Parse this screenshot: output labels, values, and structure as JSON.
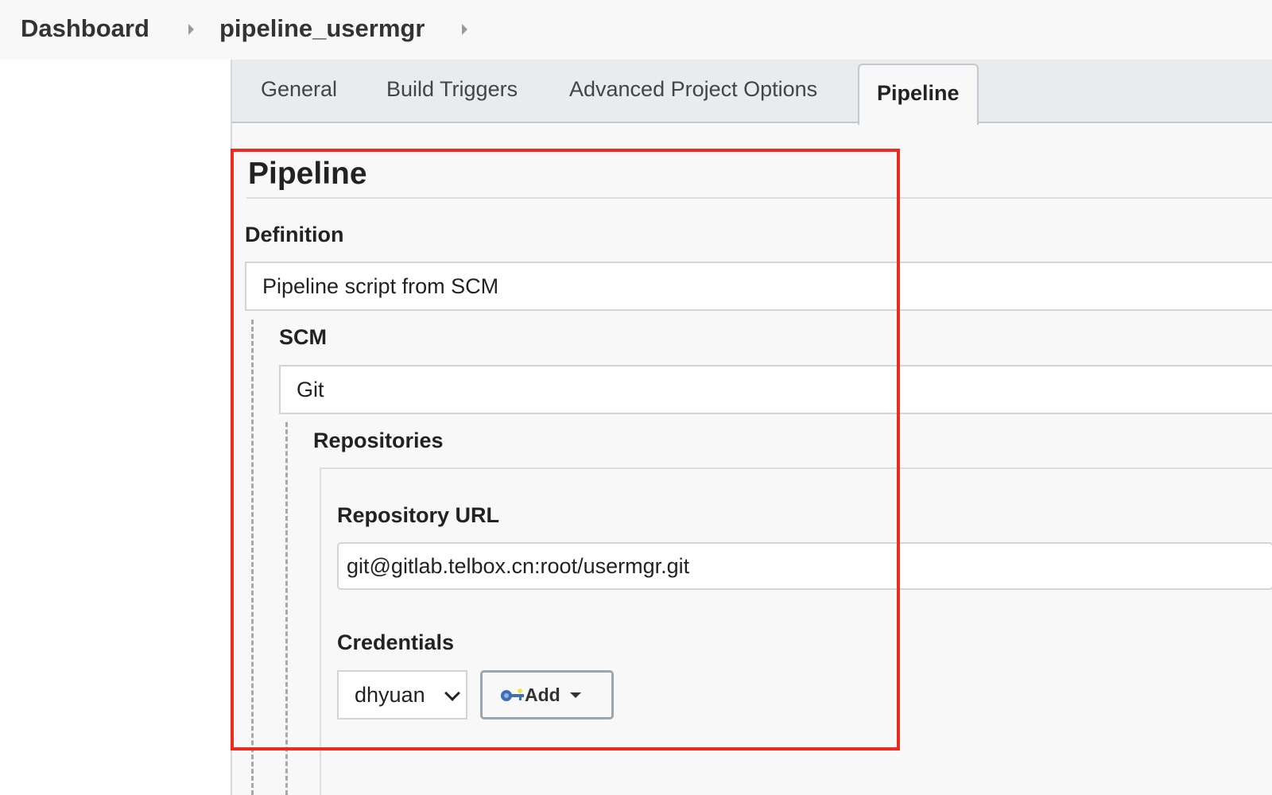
{
  "breadcrumb": {
    "items": [
      "Dashboard",
      "pipeline_usermgr"
    ]
  },
  "tabs": [
    {
      "label": "General",
      "active": false
    },
    {
      "label": "Build Triggers",
      "active": false
    },
    {
      "label": "Advanced Project Options",
      "active": false
    },
    {
      "label": "Pipeline",
      "active": true
    }
  ],
  "pipeline": {
    "section_title": "Pipeline",
    "definition_label": "Definition",
    "definition_value": "Pipeline script from SCM",
    "scm_label": "SCM",
    "scm_value": "Git",
    "repositories_label": "Repositories",
    "repo_url_label": "Repository URL",
    "repo_url_value": "git@gitlab.telbox.cn:root/usermgr.git",
    "credentials_label": "Credentials",
    "credentials_value": "dhyuan",
    "add_button_label": "Add"
  },
  "colors": {
    "highlight": "#ee2a1f",
    "tabbar_bg": "#e9ecee",
    "panel_bg": "#f8f8f8"
  },
  "icons": {
    "breadcrumb_separator": "caret-right-icon",
    "add_button_key": "key-icon",
    "add_button_caret": "caret-down-icon",
    "credentials_select": "chevron-down-icon"
  }
}
